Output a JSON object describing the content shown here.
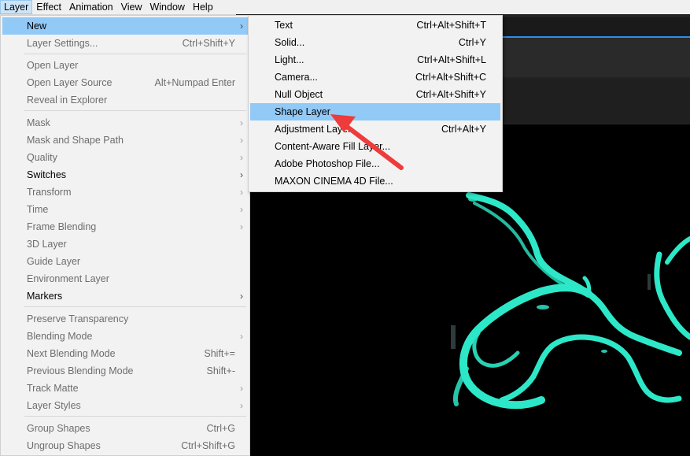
{
  "menubar": {
    "items": [
      "Layer",
      "Effect",
      "Animation",
      "View",
      "Window",
      "Help"
    ]
  },
  "layer_menu": {
    "items": [
      {
        "label": "New",
        "arrow": "›"
      },
      {
        "label": "Layer Settings...",
        "shortcut": "Ctrl+Shift+Y"
      },
      {
        "label": "Open Layer"
      },
      {
        "label": "Open Layer Source",
        "shortcut": "Alt+Numpad Enter"
      },
      {
        "label": "Reveal in Explorer"
      },
      {
        "label": "Mask",
        "arrow": "›"
      },
      {
        "label": "Mask and Shape Path",
        "arrow": "›"
      },
      {
        "label": "Quality",
        "arrow": "›"
      },
      {
        "label": "Switches",
        "arrow": "›"
      },
      {
        "label": "Transform",
        "arrow": "›"
      },
      {
        "label": "Time",
        "arrow": "›"
      },
      {
        "label": "Frame Blending",
        "arrow": "›"
      },
      {
        "label": "3D Layer"
      },
      {
        "label": "Guide Layer"
      },
      {
        "label": "Environment Layer"
      },
      {
        "label": "Markers",
        "arrow": "›"
      },
      {
        "label": "Preserve Transparency"
      },
      {
        "label": "Blending Mode",
        "arrow": "›"
      },
      {
        "label": "Next Blending Mode",
        "shortcut": "Shift+="
      },
      {
        "label": "Previous Blending Mode",
        "shortcut": "Shift+-"
      },
      {
        "label": "Track Matte",
        "arrow": "›"
      },
      {
        "label": "Layer Styles",
        "arrow": "›"
      },
      {
        "label": "Group Shapes",
        "shortcut": "Ctrl+G"
      },
      {
        "label": "Ungroup Shapes",
        "shortcut": "Ctrl+Shift+G"
      }
    ]
  },
  "new_submenu": {
    "items": [
      {
        "label": "Text",
        "shortcut": "Ctrl+Alt+Shift+T"
      },
      {
        "label": "Solid...",
        "shortcut": "Ctrl+Y"
      },
      {
        "label": "Light...",
        "shortcut": "Ctrl+Alt+Shift+L"
      },
      {
        "label": "Camera...",
        "shortcut": "Ctrl+Alt+Shift+C"
      },
      {
        "label": "Null Object",
        "shortcut": "Ctrl+Alt+Shift+Y"
      },
      {
        "label": "Shape Layer"
      },
      {
        "label": "Adjustment Layer",
        "shortcut": "Ctrl+Alt+Y"
      },
      {
        "label": "Content-Aware Fill Layer..."
      },
      {
        "label": "Adobe Photoshop File..."
      },
      {
        "label": "MAXON CINEMA 4D File..."
      }
    ]
  },
  "colors": {
    "highlight": "#91c9f7",
    "menubar_open": "#cce4f7",
    "stroke_teal": "#2de8c8",
    "annotation_arrow": "#ee3b3b",
    "timeline_blue": "#2d8ceb"
  },
  "icons": {
    "submenu_arrow": "chevron-right-icon",
    "annotation": "red-arrow-icon"
  }
}
